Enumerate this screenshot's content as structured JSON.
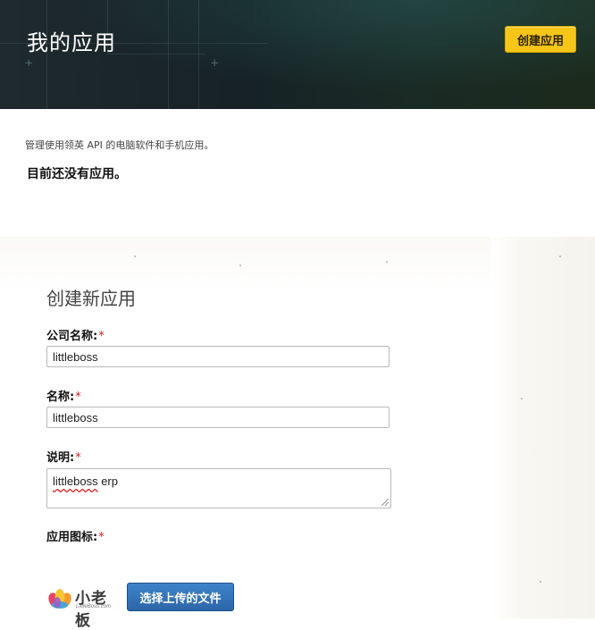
{
  "header": {
    "title": "我的应用",
    "create_button": "创建应用"
  },
  "intro": {
    "description": "管理使用领英 API 的电脑软件和手机应用。",
    "empty_message": "目前还没有应用。"
  },
  "form": {
    "title": "创建新应用",
    "company": {
      "label": "公司名称:",
      "required": "*",
      "value": "littleboss"
    },
    "name": {
      "label": "名称:",
      "required": "*",
      "value": "littleboss"
    },
    "description": {
      "label": "说明:",
      "required": "*",
      "value_word1": "littleboss",
      "value_word2": " erp"
    },
    "app_icon": {
      "label": "应用图标:",
      "required": "*"
    },
    "logo": {
      "text": "小老板",
      "subtext": "LittleBoss.com"
    },
    "upload_button": "选择上传的文件"
  },
  "colors": {
    "accent_yellow": "#f5c518",
    "upload_blue": "#2c66a8",
    "required_red": "#cc2222"
  },
  "icons": {
    "logo_mark": "lotus-logo-icon"
  }
}
